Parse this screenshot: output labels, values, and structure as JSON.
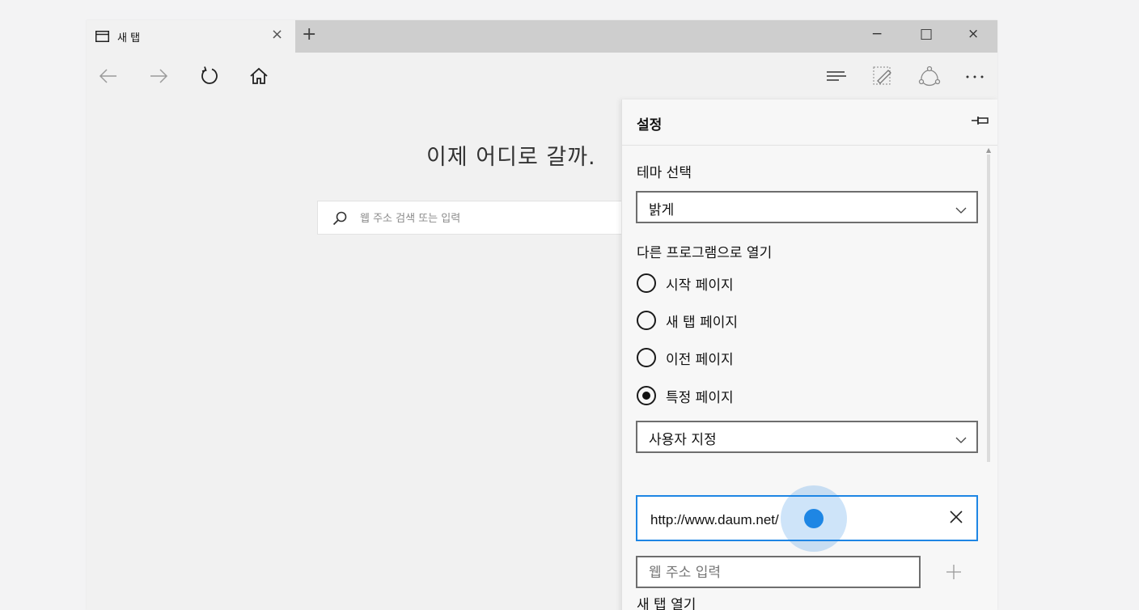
{
  "browser": {
    "tab_title": "새 탭",
    "tab_close": "×",
    "new_tab": "+",
    "window_controls": {
      "minimize": "−",
      "maximize": "□",
      "close": "×"
    }
  },
  "newtab_page": {
    "headline": "이제 어디로 갈까.",
    "search_placeholder": "웹 주소 검색 또는 입력"
  },
  "settings": {
    "title": "설정",
    "theme": {
      "label": "테마 선택",
      "selected": "밝게"
    },
    "open_with": {
      "label": "다른 프로그램으로 열기",
      "options": [
        {
          "label": "시작 페이지",
          "checked": false
        },
        {
          "label": "새 탭 페이지",
          "checked": false
        },
        {
          "label": "이전 페이지",
          "checked": false
        },
        {
          "label": "특정 페이지",
          "checked": true
        }
      ],
      "page_select": "사용자 지정",
      "url_value": "http://www.daum.net/",
      "url_placeholder": "웹 주소 입력"
    },
    "next_section_label": "새 탭 열기"
  },
  "colors": {
    "accent": "#1e86e4",
    "tabstrip": "#cecece",
    "page": "#f1f1f1"
  },
  "icons": [
    "tab-page-icon",
    "back-arrow-icon",
    "forward-arrow-icon",
    "refresh-icon",
    "home-icon",
    "hub-icon",
    "web-note-icon",
    "share-icon",
    "more-icon",
    "search-icon",
    "pin-icon",
    "chevron-down-icon",
    "clear-icon",
    "add-icon"
  ]
}
